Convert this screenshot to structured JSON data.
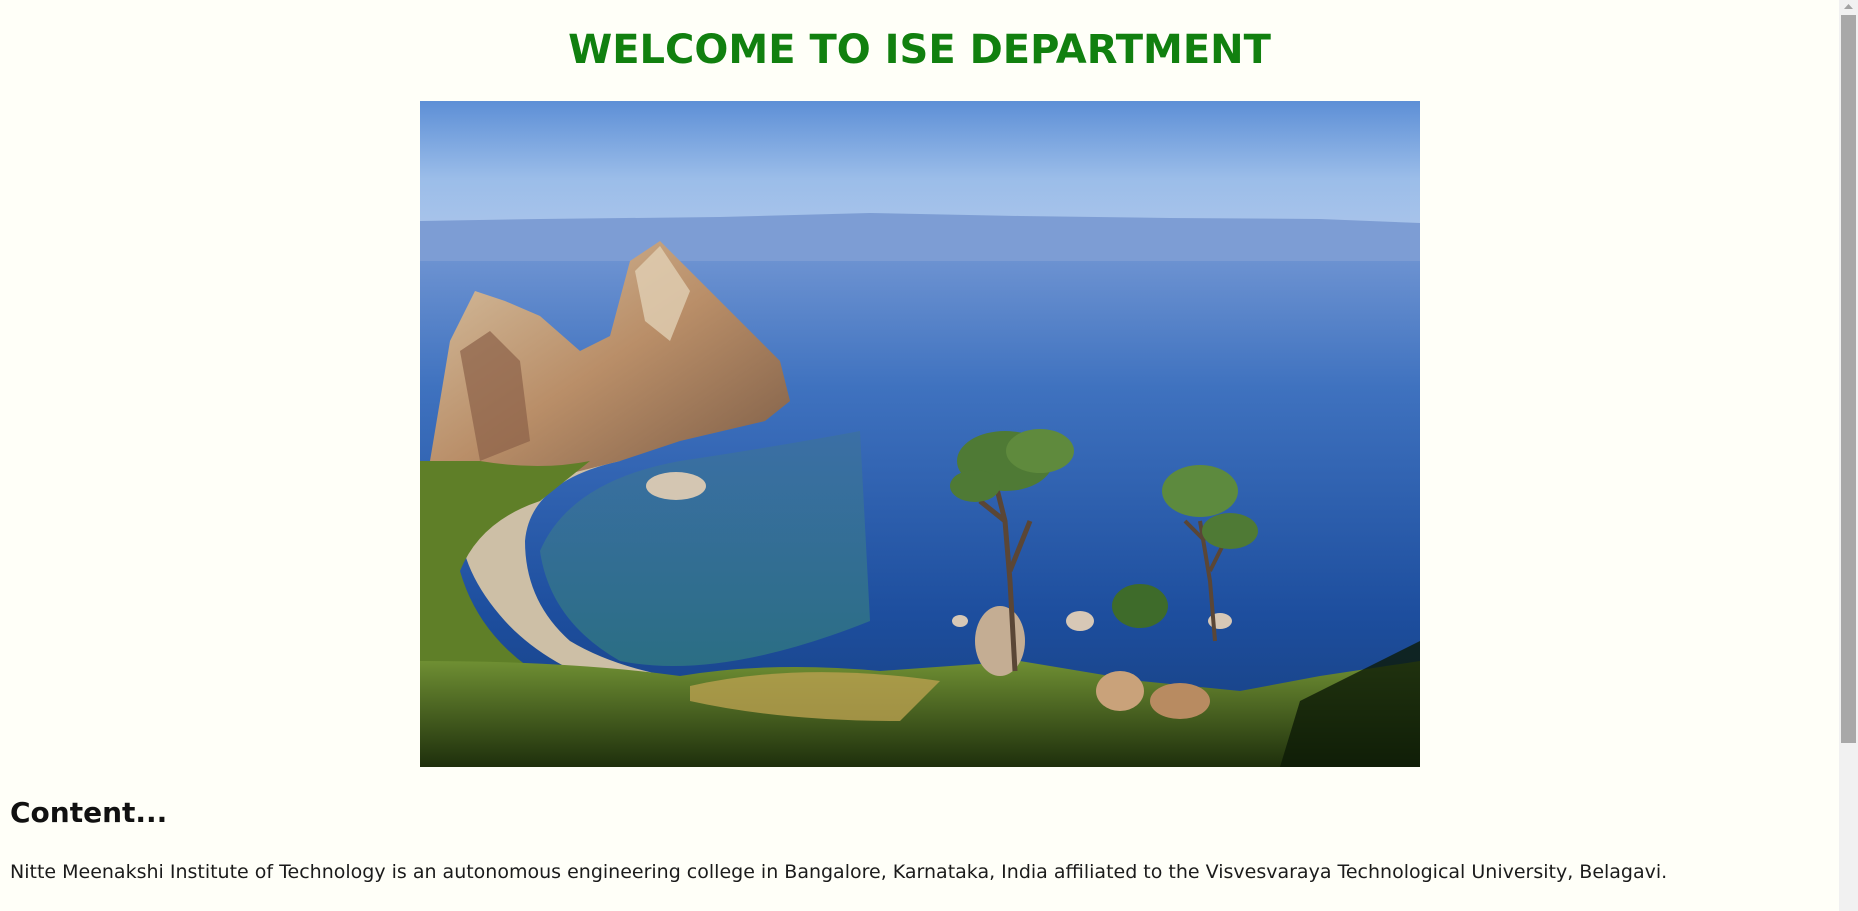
{
  "page": {
    "title": "WELCOME TO ISE DEPARTMENT",
    "title_color": "#11800f",
    "background_color": "#fffff8"
  },
  "hero_image": {
    "description_name": "lake-landscape-photo",
    "alt": "Rocky cliff by a lake"
  },
  "content": {
    "heading": "Content...",
    "paragraph": "Nitte Meenakshi Institute of Technology is an autonomous engineering college in Bangalore, Karnataka, India affiliated to the Visvesvaraya Technological University, Belagavi."
  },
  "scrollbar": {
    "up_arrow_icon": "triangle-up-icon"
  }
}
